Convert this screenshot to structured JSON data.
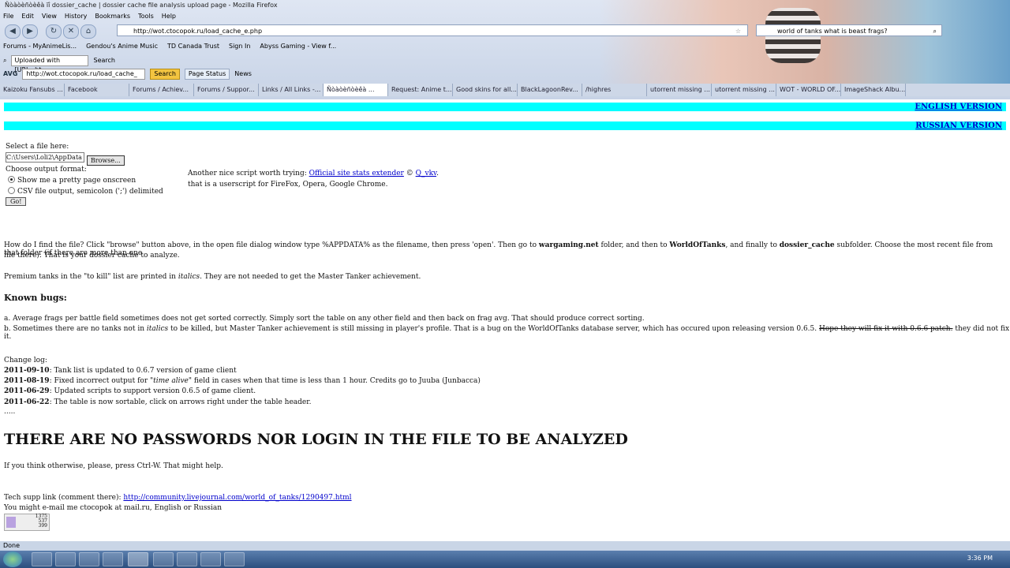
{
  "window": {
    "title": "Ñòàòèñòèêà ïî dossier_cache | dossier cache file analysis upload page - Mozilla Firefox"
  },
  "menu": [
    "File",
    "Edit",
    "View",
    "History",
    "Bookmarks",
    "Tools",
    "Help"
  ],
  "nav": {
    "url": "http://wot.ctocopok.ru/load_cache_e.php",
    "search_value": "world of tanks what is beast frags?"
  },
  "bookmarks": [
    "Forums - MyAnimeLis...",
    "Gendou's Anime Music",
    "TD Canada Trust",
    "Sign In",
    "Abyss Gaming - View f..."
  ],
  "toolbar2": {
    "select": "Uploaded with [URL=ht",
    "search": "Search"
  },
  "toolbar3": {
    "avg": "AVG",
    "url": "http://wot.ctocopok.ru/load_cache_",
    "search": "Search",
    "page_status": "Page Status",
    "news": "News",
    "support": "Support"
  },
  "tabs": [
    "Kaizoku Fansubs ...",
    "Facebook",
    "Forums / Achiev...",
    "Forums / Suppor...",
    "Links / All Links -...",
    "Ñòàòèñòèêà ...",
    "Request: Anime t...",
    "Good skins for all...",
    "BlackLagoonRev...",
    "/highres",
    "utorrent missing ...",
    "utorrent missing ...",
    "WOT - WORLD OF...",
    "ImageShack Albu..."
  ],
  "page": {
    "english_version": "ENGLISH VERSION",
    "russian_version": "RUSSIAN VERSION",
    "select_file_label": "Select a file here:",
    "file_value": "C:\\Users\\Loli2\\AppData",
    "browse_label": "Browse...",
    "output_format_label": "Choose output format:",
    "option_pretty": "Show me a pretty page onscreen",
    "option_csv": "CSV file output, semicolon (';') delimited",
    "go_label": "Go!",
    "script_intro": "Another nice script worth trying:",
    "script_link": "Official site stats extender",
    "script_copyright": "©",
    "script_author": "Q_vkv",
    "script_desc": "that is a userscript for FireFox, Opera, Google Chrome.",
    "howto_a": "How do I find the file? Click \"browse\" button above, in the open file dialog window type %APPDATA% as the filename, then press 'open'. Then go to",
    "howto_b1": "wargaming.net",
    "howto_c": "folder, and then to",
    "howto_b2": "WorldOfTanks",
    "howto_d": ", and finally to",
    "howto_b3": "dossier_cache",
    "howto_e": "subfolder. Choose the most recent file from that folder (if there are more than one",
    "howto_line2": "file there). That is your dossier cache to analyze.",
    "premium_a": "Premium tanks in the \"to kill\" list are printed in",
    "premium_i": "italics",
    "premium_b": ". They are not needed to get the Master Tanker achievement.",
    "known_bugs": "Known bugs:",
    "bug_a": "a. Average frags per battle field sometimes does not get sorted correctly. Simply sort the table on any other field and then back on frag avg. That should produce correct sorting.",
    "bug_b1": "b. Sometimes there are no tanks not in",
    "bug_b_i": "italics",
    "bug_b2": "to be killed, but Master Tanker achievement is still missing in player's profile. That is a bug on the WorldOfTanks database server, which has occured upon releasing version 0.6.5.",
    "bug_b_strike": "Hope they will fix it with 0.6.6 patch.",
    "bug_b3": "they did not fix it.",
    "changelog_title": "Change log:",
    "changelog": [
      {
        "date": "2011-09-10",
        "text": ": Tank list is updated to 0.6.7 version of game client"
      },
      {
        "date": "2011-08-19",
        "text": ": Fixed incorrect output for \"",
        "italic": "time alive",
        "text2": "\" field in cases when that time is less than 1 hour. Credits go to Juuba (Junbacca)"
      },
      {
        "date": "2011-06-29",
        "text": ": Updated scripts to support version 0.6.5 of game client."
      },
      {
        "date": "2011-06-22",
        "text": ": The table is now sortable, click on arrows right under the table header."
      }
    ],
    "dots": ".....",
    "headline": "THERE ARE NO PASSWORDS NOR LOGIN IN THE FILE TO BE ANALYZED",
    "ctrlw": "If you think otherwise, please, press Ctrl-W. That might help.",
    "tech_label": "Tech supp link (comment there):",
    "tech_link": "http://community.livejournal.com/world_of_tanks/1290497.html",
    "email_line": "You might e-mail me ctocopok at mail.ru, English or Russian",
    "counter": [
      "1375",
      "537",
      "399"
    ]
  },
  "status": {
    "text": "Done"
  },
  "taskbar": {
    "time": "3:36 PM"
  }
}
